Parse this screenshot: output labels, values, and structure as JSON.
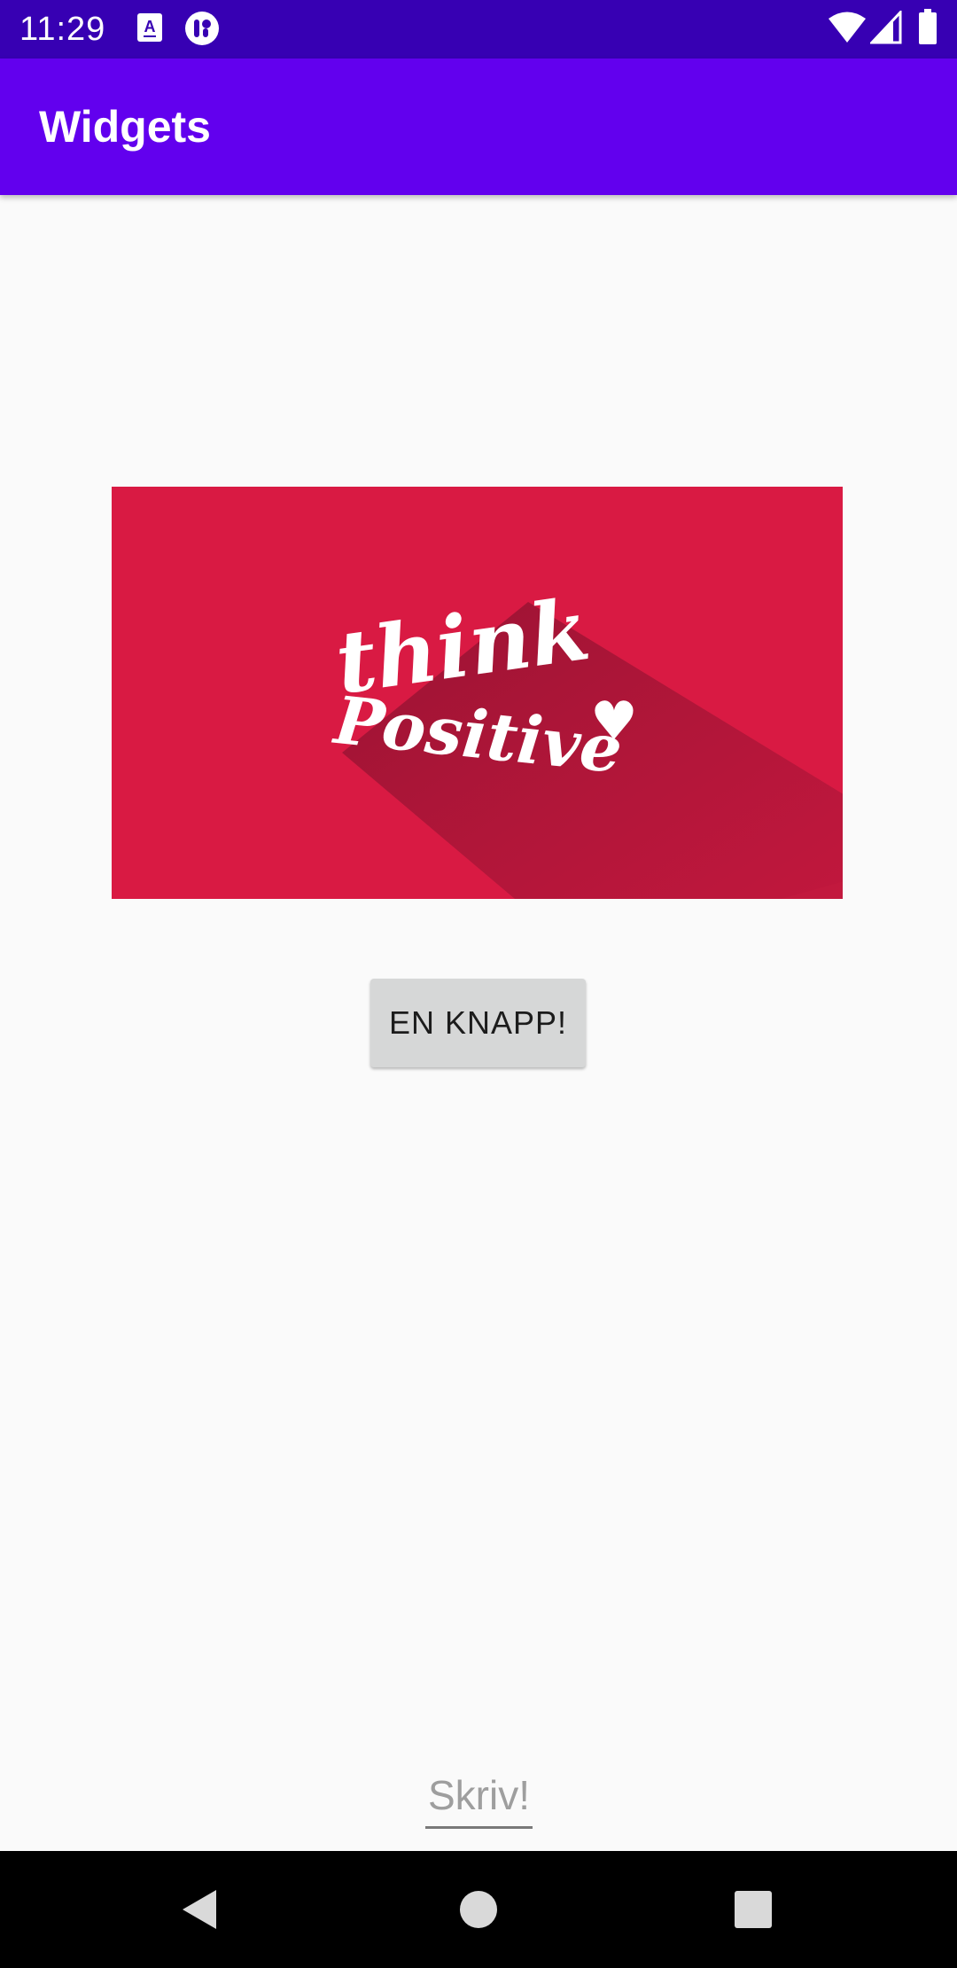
{
  "status_bar": {
    "time": "11:29",
    "icons": [
      "text-a-notification-icon",
      "accessibility-notification-icon",
      "wifi-icon",
      "signal-icon",
      "battery-icon"
    ]
  },
  "app_bar": {
    "title": "Widgets",
    "color": "#6200ee",
    "status_color": "#3700b3"
  },
  "main": {
    "image": {
      "text_line1": "think",
      "text_line2": "Positive",
      "background": "#d91a43",
      "heart": "♥"
    },
    "button": {
      "label": "EN KNAPP!"
    },
    "input": {
      "placeholder": "Skriv!",
      "value": ""
    }
  },
  "navigation": {
    "buttons": [
      "back-icon",
      "home-icon",
      "recents-icon"
    ]
  }
}
